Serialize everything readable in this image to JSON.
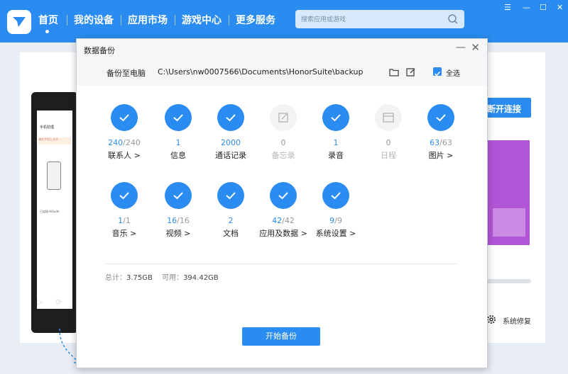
{
  "app": {
    "nav": [
      "首页",
      "我的设备",
      "应用市场",
      "游戏中心",
      "更多服务"
    ],
    "search_placeholder": "搜索应用或游戏",
    "window_controls": [
      "☰",
      "—",
      "☐",
      "✕"
    ]
  },
  "background": {
    "phone_title": "手机助理",
    "phone_note": "请在手机上允许…",
    "phone_status": "已连接 HiSuite",
    "connect_button": "断开连接",
    "repair_label": "系统修复"
  },
  "dialog": {
    "title": "数据备份",
    "backup_to_pc_label": "备份至电脑",
    "backup_path": "C:\\Users\\nw0007566\\Documents\\HonorSuite\\backup",
    "select_all_label": "全选",
    "items": [
      {
        "label": "联系人 >",
        "done": "240",
        "total": "/240",
        "enabled": true
      },
      {
        "label": "信息",
        "done": "1",
        "total": "",
        "enabled": true
      },
      {
        "label": "通话记录",
        "done": "2000",
        "total": "",
        "enabled": true
      },
      {
        "label": "备忘录",
        "done": "0",
        "total": "",
        "enabled": false
      },
      {
        "label": "录音",
        "done": "1",
        "total": "",
        "enabled": true
      },
      {
        "label": "日程",
        "done": "0",
        "total": "",
        "enabled": false
      },
      {
        "label": "图片 >",
        "done": "63",
        "total": "/63",
        "enabled": true
      },
      {
        "label": "音乐 >",
        "done": "1",
        "total": "/1",
        "enabled": true
      },
      {
        "label": "视频 >",
        "done": "16",
        "total": "/16",
        "enabled": true
      },
      {
        "label": "文档",
        "done": "2",
        "total": "",
        "enabled": true
      },
      {
        "label": "应用及数据 >",
        "done": "42",
        "total": "/42",
        "enabled": true
      },
      {
        "label": "系统设置 >",
        "done": "9",
        "total": "/9",
        "enabled": true
      }
    ],
    "total_label": "总计：",
    "total_value": "3.75GB",
    "available_label": "可用：",
    "available_value": "394.42GB",
    "start_button": "开始备份"
  },
  "colors": {
    "accent": "#2a8cf0"
  }
}
